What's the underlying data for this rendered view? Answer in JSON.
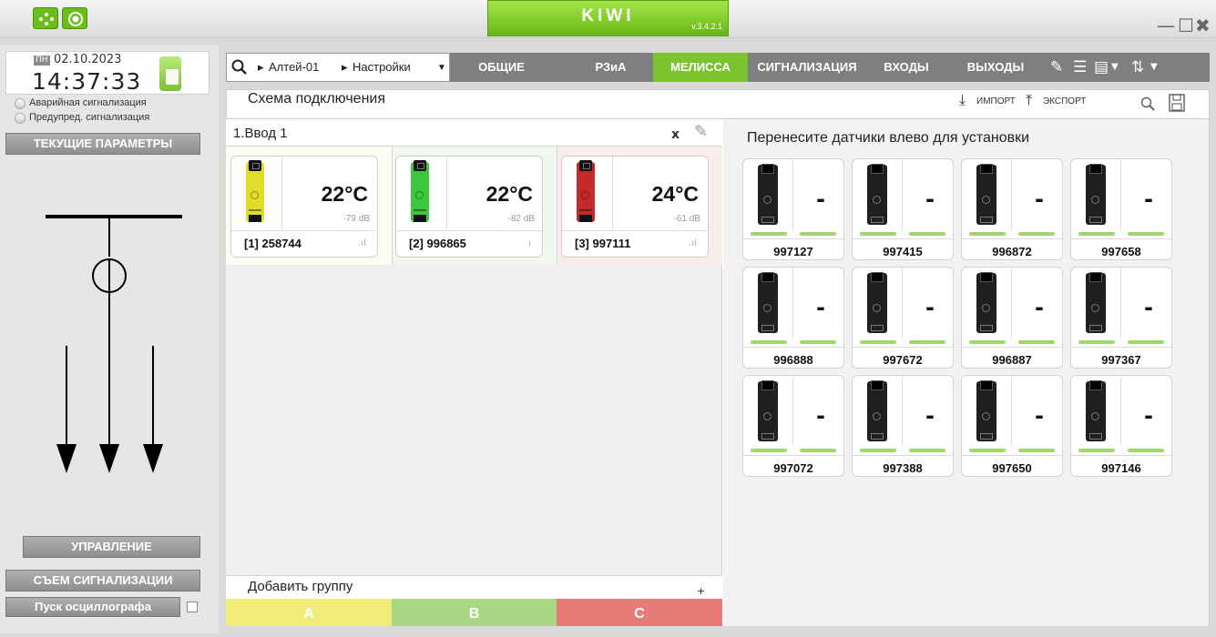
{
  "app": {
    "name": "KIWI",
    "version": "v.3.4.2.1"
  },
  "window": {
    "minimize": "—",
    "maximize": "☐",
    "close": "✖"
  },
  "clock": {
    "day": "ПН",
    "date": "02.10.2023",
    "time": "14:37:33"
  },
  "signals": {
    "alarm": "Аварийная сигнализация",
    "warning": "Предупред. сигнализация"
  },
  "left_buttons": {
    "current": "ТЕКУЩИЕ ПАРАМЕТРЫ",
    "control": "УПРАВЛЕНИЕ",
    "reset": "СЪЕМ СИГНАЛИЗАЦИИ",
    "osc": "Пуск осциллографа"
  },
  "breadcrumb": {
    "item1": "Алтей-01",
    "item2": "Настройки"
  },
  "tabs": [
    "ОБЩИЕ",
    "РЗиА",
    "МЕЛИССА",
    "СИГНАЛИЗАЦИЯ",
    "ВХОДЫ",
    "ВЫХОДЫ"
  ],
  "active_tab": "МЕЛИССА",
  "page": {
    "title": "Схема подключения",
    "import": "ИМПОРТ",
    "export": "ЭКСПОРТ"
  },
  "group": {
    "title": "1.Ввод 1",
    "close": "x"
  },
  "sensors": [
    {
      "temp": "22°C",
      "db": "-79 dB",
      "id": "[1] 258744",
      "color": "#e0dc2a"
    },
    {
      "temp": "22°C",
      "db": "-82 dB",
      "id": "[2] 996865",
      "color": "#3cc83c"
    },
    {
      "temp": "24°C",
      "db": "-61 dB",
      "id": "[3] 997111",
      "color": "#c42a2a"
    }
  ],
  "add_group": {
    "label": "Добавить группу",
    "plus": "+"
  },
  "phases": [
    {
      "label": "A",
      "color": "#f2ec7a"
    },
    {
      "label": "B",
      "color": "#a9d883"
    },
    {
      "label": "C",
      "color": "#e77b77"
    }
  ],
  "available_title": "Перенесите датчики влево для установки",
  "available": [
    {
      "id": "997127",
      "value": "-"
    },
    {
      "id": "997415",
      "value": "-"
    },
    {
      "id": "996872",
      "value": "-"
    },
    {
      "id": "997658",
      "value": "-"
    },
    {
      "id": "996888",
      "value": "-"
    },
    {
      "id": "997672",
      "value": "-"
    },
    {
      "id": "996887",
      "value": "-"
    },
    {
      "id": "997367",
      "value": "-"
    },
    {
      "id": "997072",
      "value": "-"
    },
    {
      "id": "997388",
      "value": "-"
    },
    {
      "id": "997650",
      "value": "-"
    },
    {
      "id": "997146",
      "value": "-"
    }
  ]
}
